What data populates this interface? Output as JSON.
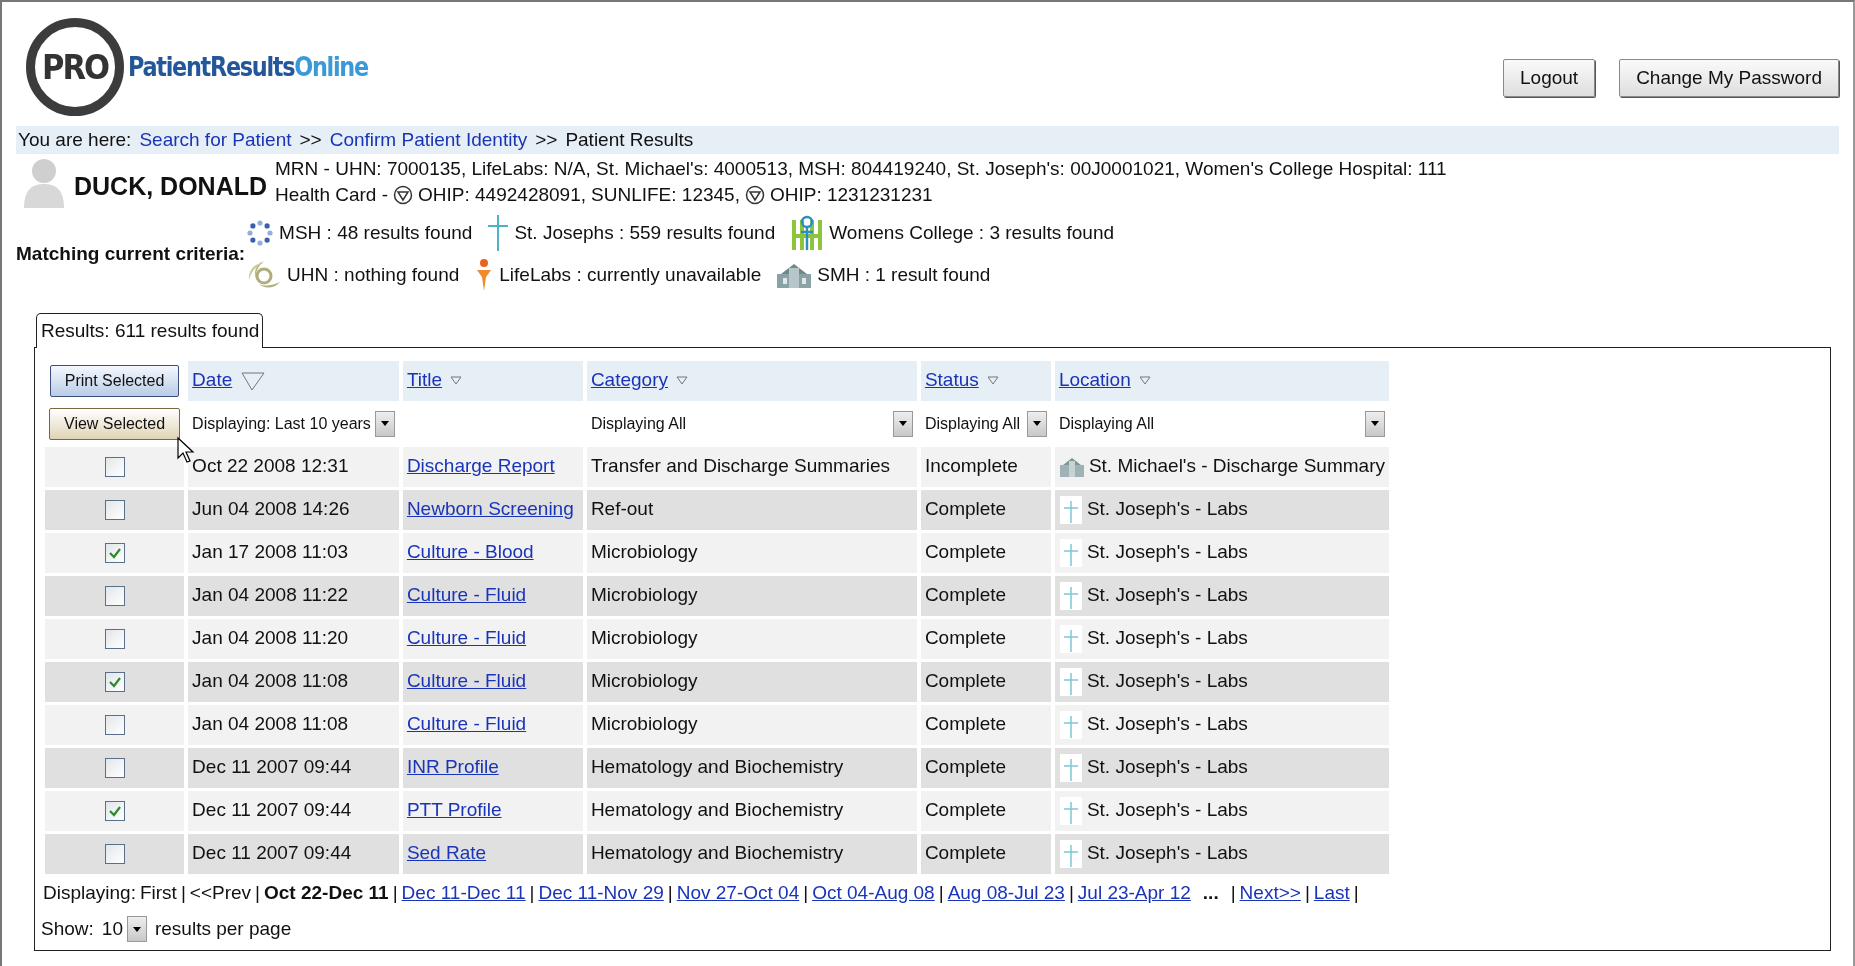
{
  "header": {
    "logo": {
      "badge": "PRO",
      "name": "PatientResults",
      "name_accent": "Online"
    },
    "buttons": [
      "Logout",
      "Change My Password"
    ]
  },
  "breadcrumb": {
    "label": "You are here:",
    "separator": ">>",
    "items": [
      {
        "text": "Search for Patient",
        "link": true
      },
      {
        "text": "Confirm Patient Identity",
        "link": true
      },
      {
        "text": "Patient Results",
        "link": false
      }
    ]
  },
  "patient": {
    "name": "DUCK, DONALD",
    "ids": "MRN - UHN: 7000135, LifeLabs: N/A, St. Michael's: 4000513, MSH: 804419240, St. Joseph's: 00J0001021, Women's College Hospital: 111",
    "health_card": [
      {
        "icon": false,
        "text": "Health Card -"
      },
      {
        "icon": true,
        "text": "OHIP: 4492428091,"
      },
      {
        "icon": false,
        "text": "SUNLIFE: 12345,"
      },
      {
        "icon": true,
        "text": "OHIP: 1231231231"
      }
    ]
  },
  "criteria": {
    "label": "Matching current criteria:",
    "lines": [
      {
        "sources": [
          {
            "kind": "msh",
            "text": "MSH : 48 results found"
          },
          {
            "kind": "joseph",
            "text": "St. Josephs : 559 results found"
          },
          {
            "kind": "womens",
            "text": "Womens College : 3 results found"
          }
        ]
      },
      {
        "sources": [
          {
            "kind": "uhn",
            "text": "UHN : nothing found"
          },
          {
            "kind": "lifelabs",
            "text": "LifeLabs : currently unavailable"
          },
          {
            "kind": "smh",
            "text": "SMH : 1 result found"
          }
        ]
      }
    ]
  },
  "results": {
    "tab": "Results: 611 results found",
    "print_button": "Print Selected",
    "view_button": "View Selected",
    "columns": [
      {
        "label": "Date",
        "sorted": true,
        "filter": "Displaying: Last 10 years"
      },
      {
        "label": "Title",
        "sorted": false
      },
      {
        "label": "Category",
        "sorted": false,
        "filter": "Displaying All"
      },
      {
        "label": "Status",
        "sorted": false,
        "filter": "Displaying All"
      },
      {
        "label": "Location",
        "sorted": false,
        "filter": "Displaying All"
      }
    ],
    "rows": [
      {
        "checked": false,
        "date": "Oct 22 2008 12:31",
        "title": "Discharge Report",
        "category": "Transfer and Discharge Summaries",
        "status": "Incomplete",
        "location": "St. Michael's - Discharge Summary",
        "kind": "smh"
      },
      {
        "checked": false,
        "date": "Jun 04 2008 14:26",
        "title": "Newborn Screening",
        "category": "Ref-out",
        "status": "Complete",
        "location": "St. Joseph's - Labs",
        "kind": "joseph"
      },
      {
        "checked": true,
        "date": "Jan 17 2008 11:03",
        "title": "Culture - Blood",
        "category": "Microbiology",
        "status": "Complete",
        "location": "St. Joseph's - Labs",
        "kind": "joseph"
      },
      {
        "checked": false,
        "date": "Jan 04 2008 11:22",
        "title": "Culture - Fluid",
        "category": "Microbiology",
        "status": "Complete",
        "location": "St. Joseph's - Labs",
        "kind": "joseph"
      },
      {
        "checked": false,
        "date": "Jan 04 2008 11:20",
        "title": "Culture - Fluid",
        "category": "Microbiology",
        "status": "Complete",
        "location": "St. Joseph's - Labs",
        "kind": "joseph"
      },
      {
        "checked": true,
        "date": "Jan 04 2008 11:08",
        "title": "Culture - Fluid",
        "category": "Microbiology",
        "status": "Complete",
        "location": "St. Joseph's - Labs",
        "kind": "joseph"
      },
      {
        "checked": false,
        "date": "Jan 04 2008 11:08",
        "title": "Culture - Fluid",
        "category": "Microbiology",
        "status": "Complete",
        "location": "St. Joseph's - Labs",
        "kind": "joseph"
      },
      {
        "checked": false,
        "date": "Dec 11 2007 09:44",
        "title": "INR Profile",
        "category": "Hematology and Biochemistry",
        "status": "Complete",
        "location": "St. Joseph's - Labs",
        "kind": "joseph"
      },
      {
        "checked": true,
        "date": "Dec 11 2007 09:44",
        "title": "PTT Profile",
        "category": "Hematology and Biochemistry",
        "status": "Complete",
        "location": "St. Joseph's - Labs",
        "kind": "joseph"
      },
      {
        "checked": false,
        "date": "Dec 11 2007 09:44",
        "title": "Sed Rate",
        "category": "Hematology and Biochemistry",
        "status": "Complete",
        "location": "St. Joseph's - Labs",
        "kind": "joseph"
      }
    ],
    "pagination": {
      "label": "Displaying:",
      "items": [
        {
          "kind": "plain",
          "text": "First"
        },
        {
          "kind": "sep",
          "text": "|"
        },
        {
          "kind": "plain",
          "text": "<<Prev"
        },
        {
          "kind": "sep",
          "text": "|"
        },
        {
          "kind": "current",
          "text": "Oct 22-Dec 11"
        },
        {
          "kind": "sep",
          "text": "|"
        },
        {
          "kind": "link",
          "text": "Dec 11-Dec 11"
        },
        {
          "kind": "sep",
          "text": "|"
        },
        {
          "kind": "link",
          "text": "Dec 11-Nov 29"
        },
        {
          "kind": "sep",
          "text": "|"
        },
        {
          "kind": "link",
          "text": "Nov 27-Oct 04"
        },
        {
          "kind": "sep",
          "text": "|"
        },
        {
          "kind": "link",
          "text": "Oct 04-Aug 08"
        },
        {
          "kind": "sep",
          "text": "|"
        },
        {
          "kind": "link",
          "text": "Aug 08-Jul 23"
        },
        {
          "kind": "sep",
          "text": "|"
        },
        {
          "kind": "link",
          "text": "Jul 23-Apr 12"
        },
        {
          "kind": "ellipsis",
          "text": "..."
        },
        {
          "kind": "sep",
          "text": "|"
        },
        {
          "kind": "link",
          "text": "Next>>"
        },
        {
          "kind": "sep",
          "text": "|"
        },
        {
          "kind": "link",
          "text": "Last"
        },
        {
          "kind": "sep",
          "text": "|"
        }
      ]
    },
    "page_size": {
      "label": "Show:",
      "value": "10",
      "suffix": "results per page"
    }
  }
}
